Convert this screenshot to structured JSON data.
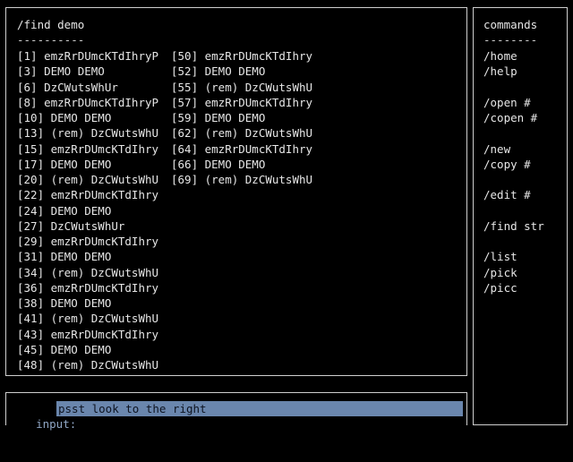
{
  "main": {
    "title": "/find demo",
    "rule": "----------",
    "results_col1": [
      "[1] emzRrDUmcKTdIhryP",
      "[3] DEMO DEMO",
      "[6] DzCWutsWhUr",
      "[8] emzRrDUmcKTdIhryP",
      "[10] DEMO DEMO",
      "[13] (rem) DzCWutsWhU",
      "[15] emzRrDUmcKTdIhry",
      "[17] DEMO DEMO",
      "[20] (rem) DzCWutsWhU",
      "[22] emzRrDUmcKTdIhry",
      "[24] DEMO DEMO",
      "[27] DzCWutsWhUr",
      "[29] emzRrDUmcKTdIhry",
      "[31] DEMO DEMO",
      "[34] (rem) DzCWutsWhU",
      "[36] emzRrDUmcKTdIhry",
      "[38] DEMO DEMO",
      "[41] (rem) DzCWutsWhU",
      "[43] emzRrDUmcKTdIhry",
      "[45] DEMO DEMO",
      "[48] (rem) DzCWutsWhU"
    ],
    "results_col2": [
      "[50] emzRrDUmcKTdIhry",
      "[52] DEMO DEMO",
      "[55] (rem) DzCWutsWhU",
      "[57] emzRrDUmcKTdIhry",
      "[59] DEMO DEMO",
      "[62] (rem) DzCWutsWhU",
      "[64] emzRrDUmcKTdIhry",
      "[66] DEMO DEMO",
      "[69] (rem) DzCWutsWhU"
    ]
  },
  "sidebar": {
    "title": "commands",
    "rule": "--------",
    "commands": [
      "/home",
      "/help",
      "",
      "/open #",
      "/copen #",
      "",
      "/new",
      "/copy #",
      "",
      "/edit #",
      "",
      "/find str",
      "",
      "/list",
      "/pick",
      "/picc"
    ]
  },
  "input": {
    "label": "input:",
    "value": "psst look to the right"
  },
  "colors": {
    "background": "#000000",
    "text": "#e6e6e6",
    "input_highlight": "#6a86ad",
    "input_label": "#8fa6c4"
  }
}
